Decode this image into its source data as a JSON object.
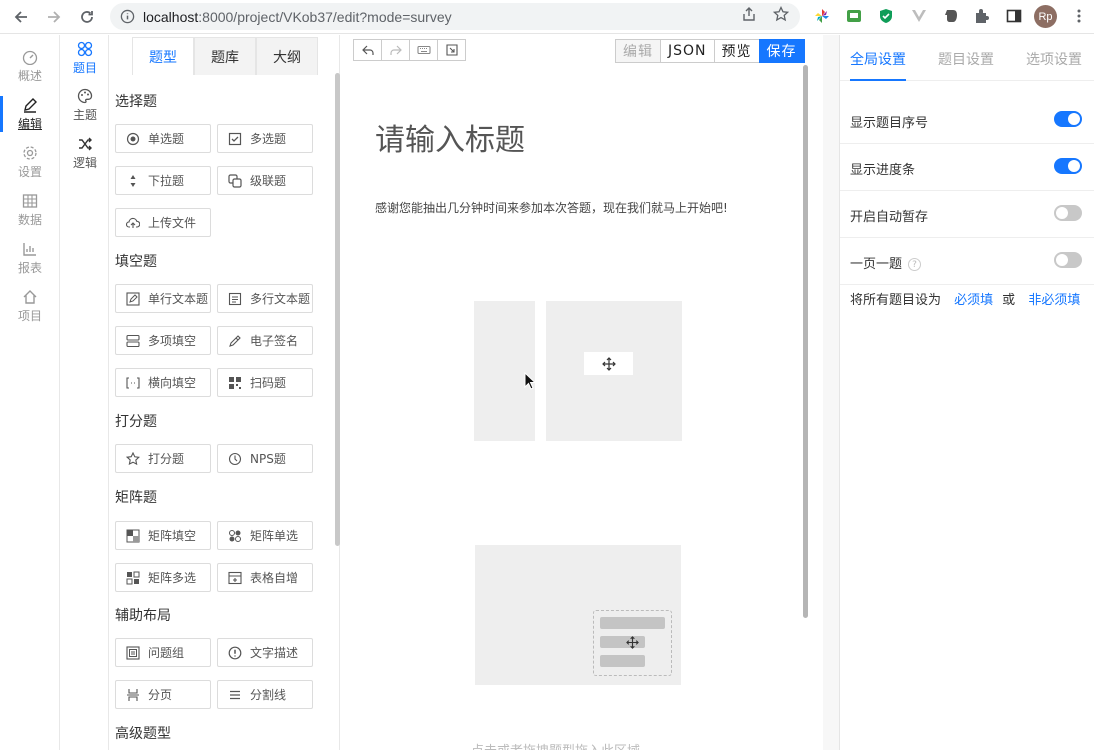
{
  "browser": {
    "url_host": "localhost",
    "url_path": ":8000/project/VKob37/edit?mode=survey",
    "profile_initials": "Rp"
  },
  "left_rail": {
    "items": [
      {
        "label": "概述",
        "icon": "dashboard-icon"
      },
      {
        "label": "编辑",
        "icon": "edit-icon"
      },
      {
        "label": "设置",
        "icon": "gear-icon"
      },
      {
        "label": "数据",
        "icon": "table-icon"
      },
      {
        "label": "报表",
        "icon": "chart-icon"
      },
      {
        "label": "项目",
        "icon": "home-icon"
      }
    ]
  },
  "sub_rail": {
    "items": [
      {
        "label": "题目",
        "icon": "grid-icon"
      },
      {
        "label": "主题",
        "icon": "palette-icon"
      },
      {
        "label": "逻辑",
        "icon": "shuffle-icon"
      }
    ]
  },
  "panel": {
    "tabs": [
      "题型",
      "题库",
      "大纲"
    ],
    "sections": [
      {
        "title": "选择题",
        "items": [
          "单选题",
          "多选题",
          "下拉题",
          "级联题",
          "上传文件"
        ]
      },
      {
        "title": "填空题",
        "items": [
          "单行文本题",
          "多行文本题",
          "多项填空",
          "电子签名",
          "横向填空",
          "扫码题"
        ]
      },
      {
        "title": "打分题",
        "items": [
          "打分题",
          "NPS题"
        ]
      },
      {
        "title": "矩阵题",
        "items": [
          "矩阵填空",
          "矩阵单选",
          "矩阵多选",
          "表格自增"
        ]
      },
      {
        "title": "辅助布局",
        "items": [
          "问题组",
          "文字描述",
          "分页",
          "分割线"
        ]
      },
      {
        "title": "高级题型",
        "items": []
      }
    ]
  },
  "toolbar": {
    "edit": "编辑",
    "json": "JSON",
    "preview": "预览",
    "save": "保存"
  },
  "canvas": {
    "title": "请输入标题",
    "description": "感谢您能抽出几分钟时间来参加本次答题，现在我们就马上开始吧!",
    "drop_hint": "点击或者拖拽题型拖入此区域"
  },
  "right_panel": {
    "tabs": [
      "全局设置",
      "题目设置",
      "选项设置"
    ],
    "settings": [
      {
        "label": "显示题目序号",
        "on": true
      },
      {
        "label": "显示进度条",
        "on": true
      },
      {
        "label": "开启自动暂存",
        "on": false
      },
      {
        "label": "一页一题",
        "on": false
      }
    ],
    "required_prefix": "将所有题目设为",
    "required_link": "必须填",
    "or": "或",
    "optional_link": "非必须填"
  },
  "colors": {
    "accent": "#1677ff"
  }
}
